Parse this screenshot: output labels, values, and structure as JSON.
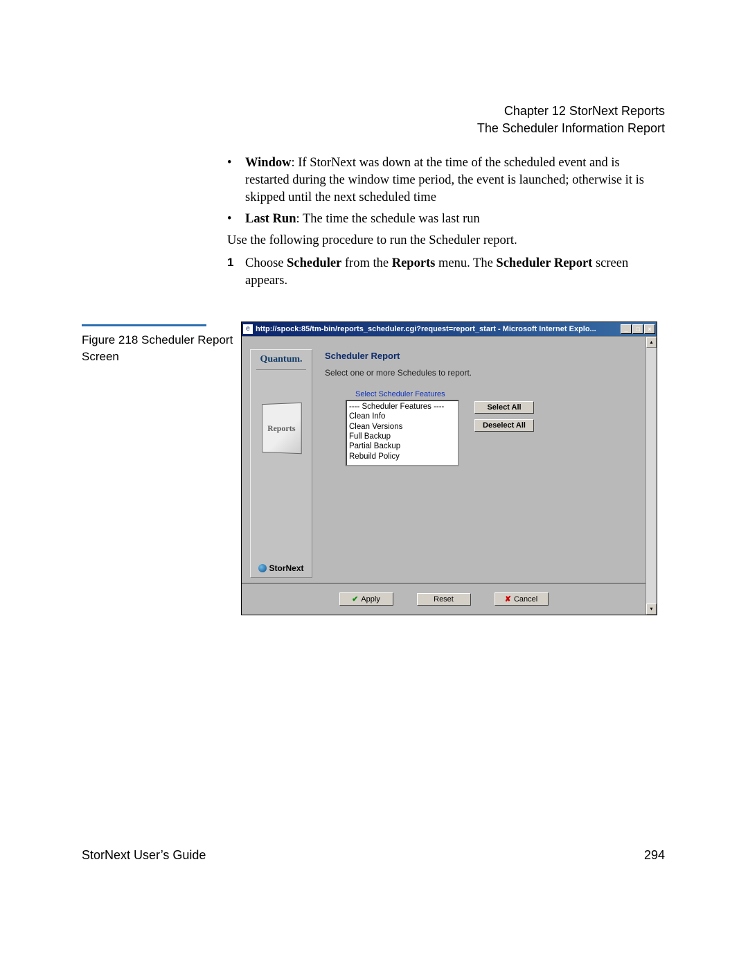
{
  "header": {
    "chapter_line": "Chapter 12  StorNext Reports",
    "section_line": "The Scheduler Information Report"
  },
  "bullets": {
    "window_label": "Window",
    "window_text": ": If StorNext was down at the time of the scheduled event and is restarted during the window time period, the event is launched; otherwise it is skipped until the next scheduled time",
    "lastrun_label": "Last Run",
    "lastrun_text": ": The time the schedule was last run"
  },
  "intro_para": "Use the following procedure to run the Scheduler report.",
  "step": {
    "num": "1",
    "pre": "Choose ",
    "menu1": "Scheduler",
    "mid1": " from the ",
    "menu2": "Reports",
    "mid2": " menu. The ",
    "menu3": "Scheduler Report",
    "post": " screen appears."
  },
  "figure_caption": "Figure 218  Scheduler Report Screen",
  "ie": {
    "title": "http://spock:85/tm-bin/reports_scheduler.cgi?request=report_start - Microsoft Internet Explo...",
    "min": "_",
    "max": "□",
    "close": "×",
    "scroll_up": "▴",
    "scroll_down": "▾"
  },
  "sidebar": {
    "brand": "Quantum.",
    "reports": "Reports",
    "stornext": "StorNext"
  },
  "report": {
    "title": "Scheduler Report",
    "subtitle": "Select one or more Schedules to report.",
    "features_head": "Select Scheduler Features",
    "features": [
      "---- Scheduler Features ----",
      "Clean Info",
      "Clean Versions",
      "Full Backup",
      "Partial Backup",
      "Rebuild Policy"
    ],
    "select_all": "Select All",
    "deselect_all": "Deselect All",
    "apply": "Apply",
    "reset": "Reset",
    "cancel": "Cancel"
  },
  "footer": {
    "left": "StorNext User’s Guide",
    "right": "294"
  }
}
